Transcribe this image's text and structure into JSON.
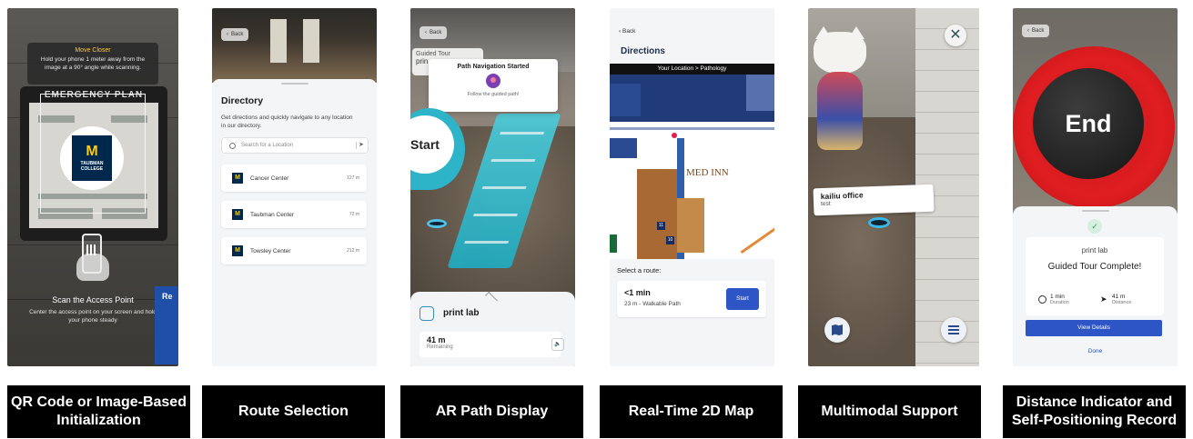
{
  "panels": {
    "qr": {
      "move_title": "Move Closer",
      "move_text": "Hold your phone 1 meter away from the image at a 90° angle while scanning.",
      "plan_title": "EMERGENCY PLAN",
      "logo_letter": "M",
      "logo_text": "TAUBMAN COLLEGE",
      "scan_title": "Scan the Access Point",
      "scan_text": "Center the access point on your screen and hold your phone steady",
      "bin_label": "Re",
      "caption": "QR Code or Image-Based Initialization"
    },
    "directory": {
      "back": "Back",
      "title": "Directory",
      "subtitle": "Get directions and quickly navigate to any location in our directory.",
      "search_placeholder": "Search for a Location",
      "locations": [
        {
          "name": "Cancer Center",
          "distance": "127 m"
        },
        {
          "name": "Taubman Center",
          "distance": "72 m"
        },
        {
          "name": "Towsley Center",
          "distance": "212 m"
        }
      ],
      "caption": "Route Selection"
    },
    "ar": {
      "back": "Back",
      "tour_line1": "Guided Tour",
      "tour_line2": "prin",
      "popup_title": "Path Navigation Started",
      "popup_sub": "Follow the guided path!",
      "start": "Start",
      "dest_name": "print lab",
      "remaining_value": "41 m",
      "remaining_label": "Remaining",
      "caption": "AR Path Display"
    },
    "map": {
      "back": "Back",
      "title": "Directions",
      "location_bar": "Your Location > Pathology",
      "med_inn": "MED INN",
      "route_label": "Select a route:",
      "route_time": "<1 min",
      "route_detail": "23 m - Walkable Path",
      "start_button": "Start",
      "caption": "Real-Time 2D Map"
    },
    "multimodal": {
      "label_name": "kailiu office",
      "label_sub": "test",
      "caption": "Multimodal Support"
    },
    "end": {
      "back": "Back",
      "end_label": "End",
      "dest": "print lab",
      "complete": "Guided Tour Complete!",
      "duration_value": "1 min",
      "duration_label": "Duration",
      "distance_value": "41 m",
      "distance_label": "Distance",
      "view_details": "View Details",
      "done": "Done",
      "caption": "Distance Indicator and Self-Positioning Record"
    }
  },
  "colors": {
    "caption_bg": "#000000",
    "primary_blue": "#2d55c6",
    "umich_blue": "#00274c",
    "umich_maize": "#ffcb05",
    "ar_path": "#2eb4c8",
    "end_red": "#e01e21"
  }
}
